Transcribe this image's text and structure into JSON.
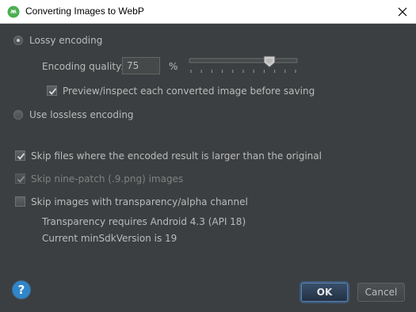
{
  "window": {
    "title": "Converting Images to WebP",
    "app_icon": "android-studio-icon",
    "close_icon": "close-icon"
  },
  "encoding": {
    "lossy_label": "Lossy encoding",
    "lossy_selected": true,
    "quality_label": "Encoding quality:",
    "quality_value": "75",
    "percent_label": "%",
    "quality_slider_level": 75,
    "preview_label": "Preview/inspect each converted image before saving",
    "preview_checked": true,
    "lossless_label": "Use lossless encoding",
    "lossless_selected": false
  },
  "options": {
    "skip_larger_label": "Skip files where the encoded result is larger than the original",
    "skip_larger_checked": true,
    "skip_ninepatch_label": "Skip nine-patch (.9.png) images",
    "skip_ninepatch_checked": true,
    "skip_ninepatch_disabled": true,
    "skip_transparency_label": "Skip images with transparency/alpha channel",
    "skip_transparency_checked": false,
    "transparency_note": "Transparency requires Android 4.3 (API 18)",
    "min_sdk_note": "Current minSdkVersion is 19"
  },
  "footer": {
    "help_label": "?",
    "ok_label": "OK",
    "cancel_label": "Cancel"
  },
  "colors": {
    "background": "#3c3f41",
    "text": "#bbbbbb",
    "accent": "#2f86c9"
  }
}
